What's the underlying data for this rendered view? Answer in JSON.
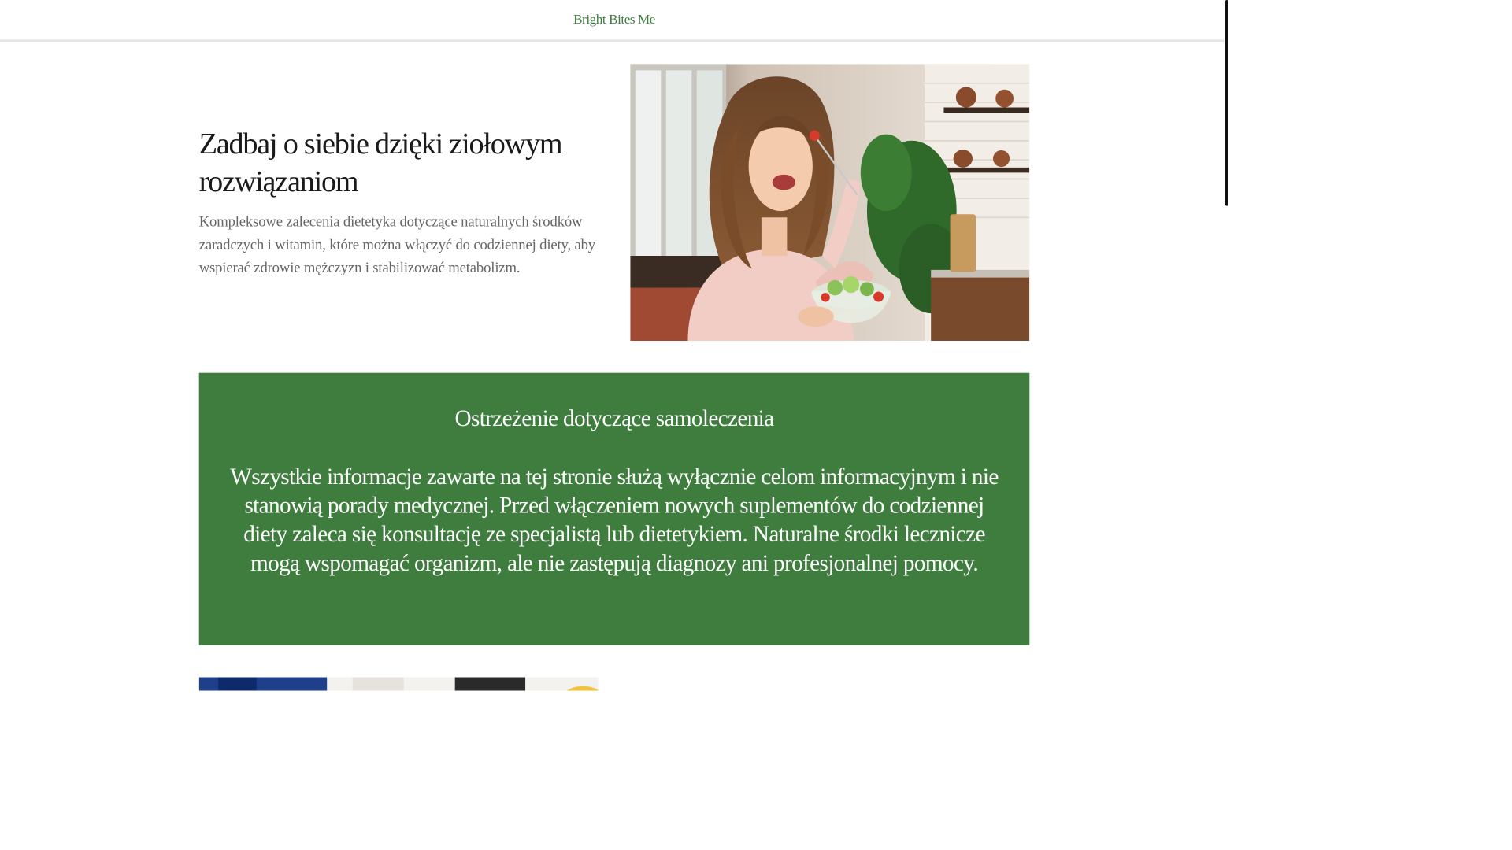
{
  "header": {
    "site_title": "Bright Bites Me"
  },
  "hero": {
    "title": "Zadbaj o siebie dzięki ziołowym rozwiązaniom",
    "description": "Kompleksowe zalecenia dietetyka dotyczące naturalnych środków zaradczych i witamin, które można włączyć do codziennej diety, aby wspierać zdrowie mężczyzn i stabilizować metabolizm.",
    "photo_icon": "woman-eating-salad-photo"
  },
  "warning": {
    "title": "Ostrzeżenie dotyczące samoleczenia",
    "body": "Wszystkie informacje zawarte na tej stronie służą wyłącznie celom informacyjnym i nie stanowią porady medycznej. Przed włączeniem nowych suplementów do codziennej diety zaleca się konsultację ze specjalistą lub dietetykiem. Naturalne środki lecznicze mogą wspomagać organizm, ale nie zastępują diagnozy ani profesjonalnej pomocy."
  },
  "colors": {
    "brand_green": "#3e7d3e",
    "text_dark": "#1a1a1a",
    "text_muted": "#666666"
  }
}
